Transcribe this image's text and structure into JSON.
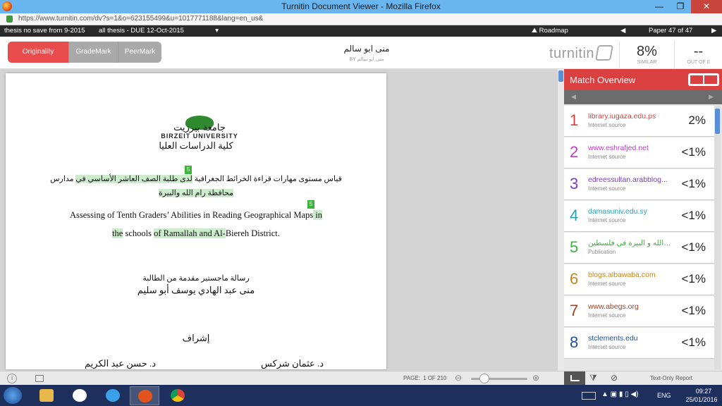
{
  "window": {
    "title": "Turnitin Document Viewer - Mozilla Firefox",
    "minimize": "—",
    "restore": "❐",
    "close": "✕"
  },
  "browser": {
    "url": "https://www.turnitin.com/dv?s=1&o=623155499&u=1017771188&lang=en_us&"
  },
  "topbar": {
    "assignment": "thesis no save from 9-2015",
    "selector": "all thesis - DUE 12-Oct-2015",
    "selector_arrow": "▾",
    "roadmap": "Roadmap",
    "prev": "◀",
    "paper": "Paper 47 of 47",
    "next": "▶"
  },
  "header": {
    "tabs": [
      "Originality",
      "GradeMark",
      "PeerMark"
    ],
    "author": "منى ابو سالم",
    "by": "BY منى ابو سالم",
    "logo": "turnitin",
    "similarity": {
      "value": "8%",
      "label": "SIMILAR"
    },
    "out_of": {
      "value": "--",
      "label": "OUT OF 0"
    }
  },
  "document": {
    "uni_ar": "جامعة بيرزيت",
    "uni_en": "BIRZEIT UNIVERSITY",
    "faculty": "كلية الدراسات العليا",
    "title_ar_1a": "قياس مستوى مهارات قراءة الخرائط الجغرافية ",
    "title_ar_1b": "لدى طلبة الصف العاشر الأساسي في",
    "title_ar_1c": " مدارس",
    "title_ar_2": "محافظة رام الله والبيرة",
    "title_en_1a": "Assessing of ",
    "title_en_1b": "Tenth Graders’ Abilities  in Reading Geographical Maps",
    "title_en_1c": " in",
    "title_en_2a": "the",
    "title_en_2b": " schools ",
    "title_en_2c": "of Ramallah and Al-",
    "title_en_2d": "Biereh District.",
    "badge": "5",
    "thesis_label": "رسالة ماجستير مقدمة من الطالبة",
    "student": "منى عبد الهادي يوسف أبو سليم",
    "supervision": "إشراف",
    "supervisor_1": "د. عثمان شركس",
    "supervisor_2": "د. حسن عبد الكريم"
  },
  "bottombar": {
    "info": "i",
    "page_label": "PAGE:",
    "page_value": "1 OF 210",
    "zoom_out": "⊖",
    "zoom_in": "⊕",
    "filter_icon": "⧩",
    "exclude_icon": "⊘",
    "report": "Text-Only Report"
  },
  "panel": {
    "title": "Match Overview",
    "nav_prev": "◀",
    "nav_next": "▶",
    "matches": [
      {
        "n": "1",
        "source": "library.iugaza.edu.ps",
        "type": "Internet source",
        "pct": "2%",
        "color": "#d9403f"
      },
      {
        "n": "2",
        "source": "www.eshrafjed.net",
        "type": "Internet source",
        "pct": "<1%",
        "color": "#c03cc0"
      },
      {
        "n": "3",
        "source": "edreessultan.arabblog...",
        "type": "Internet source",
        "pct": "<1%",
        "color": "#7a3bc4"
      },
      {
        "n": "4",
        "source": "damasuniv.edu.sy",
        "type": "Internet source",
        "pct": "<1%",
        "color": "#2aa0b8"
      },
      {
        "n": "5",
        "source": "افظة رام الله و البيرة في فلسطين...",
        "type": "Publication",
        "pct": "<1%",
        "color": "#3cb43c"
      },
      {
        "n": "6",
        "source": "blogs.albawaba.com",
        "type": "Internet source",
        "pct": "<1%",
        "color": "#c0861e"
      },
      {
        "n": "7",
        "source": "www.abegs.org",
        "type": "Internet source",
        "pct": "<1%",
        "color": "#a0421e"
      },
      {
        "n": "8",
        "source": "stclements.edu",
        "type": "Internet source",
        "pct": "<1%",
        "color": "#1e4e9c"
      }
    ]
  },
  "taskbar": {
    "tray": "▲ ▣ ▮ ▯ ◀)",
    "lang": "ENG",
    "time": "09:27",
    "date": "25/01/2016"
  }
}
